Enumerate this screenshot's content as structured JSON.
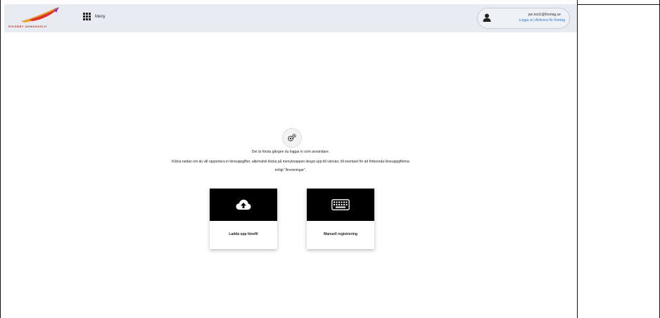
{
  "header": {
    "logo_text": "RIKSBBY ARMANSSLH",
    "menu_label": "Meny",
    "user_email": "jan.test1@foretag.se",
    "logout_label": "Logga ut",
    "separator": " | ",
    "switch_company_label": "Aktivera för företag",
    "avatar_icon": "user-icon",
    "menu_icon": "grid-menu-icon"
  },
  "main": {
    "icon": "gears-icon",
    "line1": "Det är första gången du loggar in som användare.",
    "line2": "Klicka nedan om du vill rapportera in löneuppgifter, alternativt klicka på menyknappen längst upp till vänster, till exempel för att förbereda löneuppgifterna",
    "line3": "enligt \"Anvisningar\".",
    "cards": [
      {
        "label": "Ladda upp lönefil",
        "icon": "cloud-upload-icon"
      },
      {
        "label": "Manuell registrering",
        "icon": "keyboard-icon"
      }
    ]
  },
  "colors": {
    "header_bg": "#e8ecf2",
    "link": "#3b78c4",
    "card_top": "#000000",
    "logo_orange": "#f0a030",
    "logo_red": "#d9342b"
  }
}
